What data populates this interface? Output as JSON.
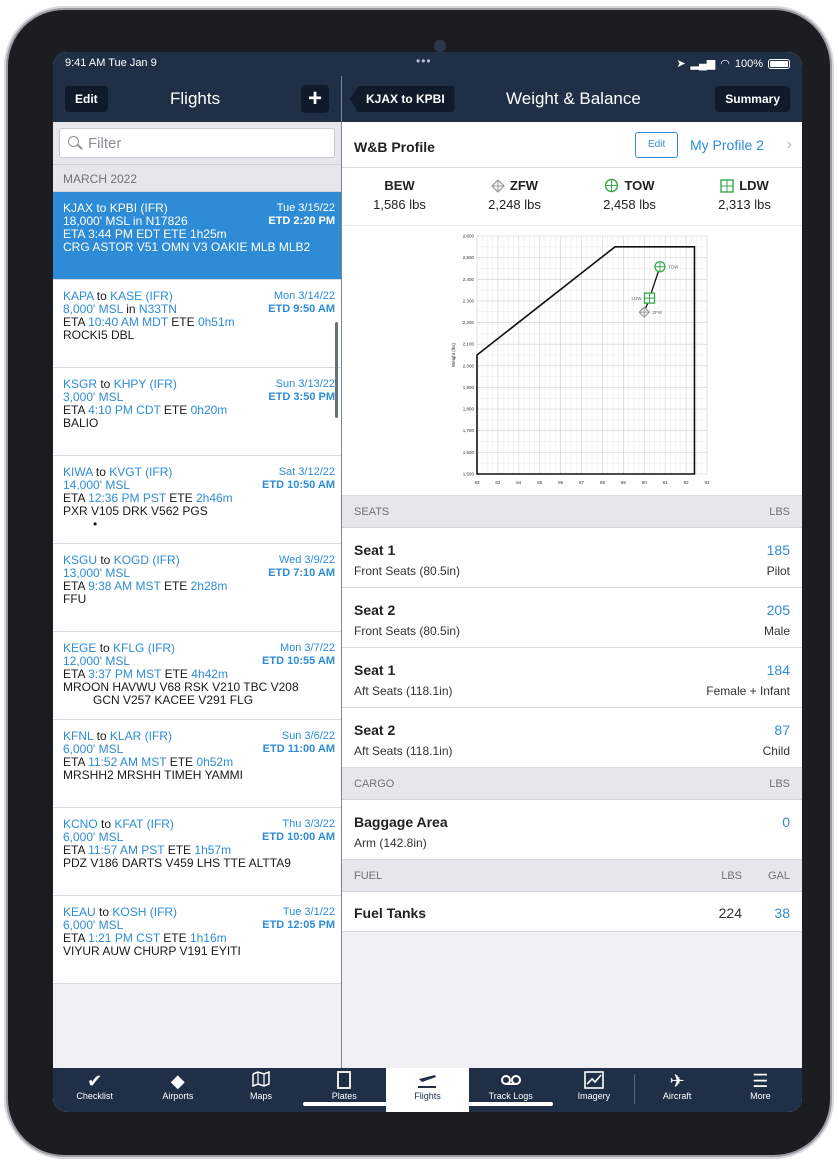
{
  "status": {
    "time": "9:41 AM  Tue Jan 9",
    "dots": "•••",
    "battery": "100%"
  },
  "left_nav": {
    "edit": "Edit",
    "title": "Flights",
    "add": "+"
  },
  "right_nav": {
    "back": "KJAX to KPBI",
    "title": "Weight & Balance",
    "summary": "Summary"
  },
  "filter": {
    "placeholder": "Filter"
  },
  "section": "MARCH 2022",
  "flights": [
    {
      "from": "KJAX",
      "to": "KPBI",
      "rules": "(IFR)",
      "date": "Tue 3/15/22",
      "alt": "18,000' MSL",
      "aircraft_prefix": " in ",
      "aircraft": "N17826",
      "etd": "ETD 2:20 PM",
      "eta": "3:44 PM EDT",
      "ete": "1h25m",
      "route": "CRG ASTOR V51 OMN V3 OAKIE MLB MLB2",
      "route2": ""
    },
    {
      "from": "KAPA",
      "to": "KASE",
      "rules": "(IFR)",
      "date": "Mon 3/14/22",
      "alt": "8,000' MSL",
      "aircraft_prefix": " in ",
      "aircraft": "N33TN",
      "etd": "ETD 9:50 AM",
      "eta": "10:40 AM MDT",
      "ete": "0h51m",
      "route": "ROCKI5 DBL",
      "route2": ""
    },
    {
      "from": "KSGR",
      "to": "KHPY",
      "rules": "(IFR)",
      "date": "Sun 3/13/22",
      "alt": "3,000' MSL",
      "aircraft_prefix": "",
      "aircraft": "",
      "etd": "ETD 3:50 PM",
      "eta": "4:10 PM CDT",
      "ete": "0h20m",
      "route": "BALIO",
      "route2": ""
    },
    {
      "from": "KIWA",
      "to": "KVGT",
      "rules": "(IFR)",
      "date": "Sat 3/12/22",
      "alt": "14,000' MSL",
      "aircraft_prefix": "",
      "aircraft": "",
      "etd": "ETD 10:50 AM",
      "eta": "12:36 PM PST",
      "ete": "2h46m",
      "route": "PXR V105 DRK V562 PGS",
      "route2": "•"
    },
    {
      "from": "KSGU",
      "to": "KOGD",
      "rules": "(IFR)",
      "date": "Wed 3/9/22",
      "alt": "13,000' MSL",
      "aircraft_prefix": "",
      "aircraft": "",
      "etd": "ETD 7:10 AM",
      "eta": "9:38 AM MST",
      "ete": "2h28m",
      "route": "FFU",
      "route2": ""
    },
    {
      "from": "KEGE",
      "to": "KFLG",
      "rules": "(IFR)",
      "date": "Mon 3/7/22",
      "alt": "12,000' MSL",
      "aircraft_prefix": "",
      "aircraft": "",
      "etd": "ETD 10:55 AM",
      "eta": "3:37 PM MST",
      "ete": "4h42m",
      "route": "MROON HAVWU V68 RSK V210 TBC V208",
      "route2": "GCN V257 KACEE V291 FLG"
    },
    {
      "from": "KFNL",
      "to": "KLAR",
      "rules": "(IFR)",
      "date": "Sun 3/6/22",
      "alt": "6,000' MSL",
      "aircraft_prefix": "",
      "aircraft": "",
      "etd": "ETD 11:00 AM",
      "eta": "11:52 AM MST",
      "ete": "0h52m",
      "route": "MRSHH2 MRSHH TIMEH YAMMI",
      "route2": ""
    },
    {
      "from": "KCNO",
      "to": "KFAT",
      "rules": "(IFR)",
      "date": "Thu 3/3/22",
      "alt": "6,000' MSL",
      "aircraft_prefix": "",
      "aircraft": "",
      "etd": "ETD 10:00 AM",
      "eta": "11:57 AM PST",
      "ete": "1h57m",
      "route": "PDZ V186 DARTS V459 LHS TTE ALTTA9",
      "route2": ""
    },
    {
      "from": "KEAU",
      "to": "KOSH",
      "rules": "(IFR)",
      "date": "Tue 3/1/22",
      "alt": "6,000' MSL",
      "aircraft_prefix": "",
      "aircraft": "",
      "etd": "ETD 12:05 PM",
      "eta": "1:21 PM CST",
      "ete": "1h16m",
      "route": "VIYUR AUW CHURP V191 EYITI",
      "route2": ""
    }
  ],
  "labels": {
    "to": " to ",
    "eta": "ETA ",
    "ete": " ETE "
  },
  "wb_profile": {
    "label": "W&B Profile",
    "edit": "Edit",
    "profile": "My Profile 2",
    "chevron": "›"
  },
  "weights": [
    {
      "name": "BEW",
      "value": "1,586 lbs",
      "icon": ""
    },
    {
      "name": "ZFW",
      "value": "2,248 lbs",
      "icon": "zfw-diamond"
    },
    {
      "name": "TOW",
      "value": "2,458 lbs",
      "icon": "tow-circle"
    },
    {
      "name": "LDW",
      "value": "2,313 lbs",
      "icon": "ldw-square"
    }
  ],
  "chart_data": {
    "type": "line",
    "ylabel": "Weight (lbs)",
    "xlim": [
      82,
      93
    ],
    "ylim": [
      1500,
      2600
    ],
    "x_ticks": [
      "82",
      "83",
      "84",
      "85",
      "86",
      "87",
      "88",
      "89",
      "90",
      "91",
      "92",
      "93"
    ],
    "y_ticks": [
      "1,500",
      "1,600",
      "1,700",
      "1,800",
      "1,900",
      "2,000",
      "2,100",
      "2,200",
      "2,300",
      "2,400",
      "2,500",
      "2,600"
    ],
    "grid": true,
    "envelope": [
      {
        "x": 82.0,
        "y": 1500
      },
      {
        "x": 82.0,
        "y": 2050
      },
      {
        "x": 88.6,
        "y": 2550
      },
      {
        "x": 92.4,
        "y": 2550
      },
      {
        "x": 92.4,
        "y": 1500
      }
    ],
    "points": [
      {
        "name": "TOW",
        "x": 90.75,
        "y": 2458
      },
      {
        "name": "LDW",
        "x": 90.25,
        "y": 2313
      },
      {
        "name": "ZFW",
        "x": 90.0,
        "y": 2248
      }
    ],
    "colors": {
      "envelope": "#111111",
      "points": "#37a84a",
      "zfw": "#999999"
    }
  },
  "seats": {
    "header": "SEATS",
    "unit": "LBS",
    "items": [
      {
        "title": "Seat 1",
        "sub": "Front Seats (80.5in)",
        "value": "185",
        "occupant": "Pilot"
      },
      {
        "title": "Seat 2",
        "sub": "Front Seats (80.5in)",
        "value": "205",
        "occupant": "Male"
      },
      {
        "title": "Seat 1",
        "sub": "Aft Seats (118.1in)",
        "value": "184",
        "occupant": "Female + Infant"
      },
      {
        "title": "Seat 2",
        "sub": "Aft Seats (118.1in)",
        "value": "87",
        "occupant": "Child"
      }
    ]
  },
  "cargo": {
    "header": "CARGO",
    "unit": "LBS",
    "title": "Baggage Area",
    "sub": "Arm (142.8in)",
    "value": "0"
  },
  "fuel": {
    "header": "FUEL",
    "unit_lbs": "LBS",
    "unit_gal": "GAL",
    "title": "Fuel Tanks",
    "lbs": "224",
    "gal": "38"
  },
  "tabs": [
    {
      "label": "Checklist",
      "icon": "check-icon"
    },
    {
      "label": "Airports",
      "icon": "airport-icon"
    },
    {
      "label": "Maps",
      "icon": "map-icon"
    },
    {
      "label": "Plates",
      "icon": "plates-icon"
    },
    {
      "label": "Flights",
      "icon": "flights-icon",
      "active": true
    },
    {
      "label": "Track Logs",
      "icon": "track-logs-icon"
    },
    {
      "label": "Imagery",
      "icon": "imagery-icon"
    },
    {
      "label": "Aircraft",
      "icon": "aircraft-icon"
    },
    {
      "label": "More",
      "icon": "more-icon"
    }
  ]
}
